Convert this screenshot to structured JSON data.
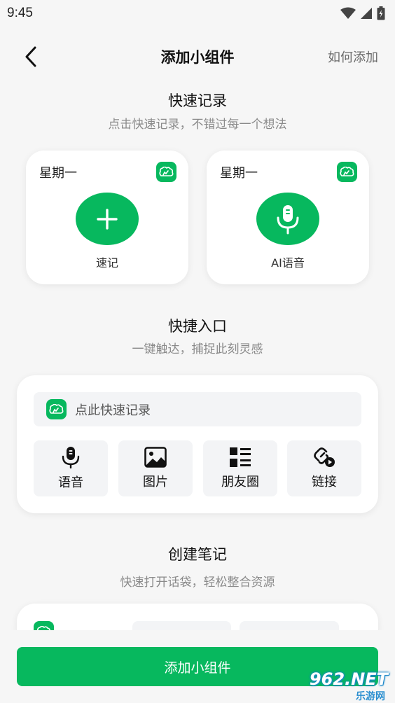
{
  "status_bar": {
    "time": "9:45"
  },
  "nav": {
    "title": "添加小组件",
    "help_label": "如何添加"
  },
  "sections": {
    "quick_record": {
      "title": "快速记录",
      "subtitle": "点击快速记录，不错过每一个想法"
    },
    "quick_entry": {
      "title": "快捷入口",
      "subtitle": "一键触达，捕捉此刻灵感"
    },
    "create_note": {
      "title": "创建笔记",
      "subtitle": "快速打开话袋，轻松整合资源"
    }
  },
  "widgets": [
    {
      "day": "星期一",
      "label": "速记",
      "icon": "plus-icon"
    },
    {
      "day": "星期一",
      "label": "AI语音",
      "icon": "microphone-icon"
    }
  ],
  "entry_card": {
    "search_placeholder": "点此快速记录",
    "buttons": [
      {
        "label": "语音",
        "icon": "microphone-icon"
      },
      {
        "label": "图片",
        "icon": "image-icon"
      },
      {
        "label": "朋友圈",
        "icon": "moments-grid-icon"
      },
      {
        "label": "链接",
        "icon": "link-play-icon"
      }
    ]
  },
  "footer": {
    "button_label": "添加小组件"
  },
  "colors": {
    "brand_green": "#07b85e",
    "background": "#f6f6f6",
    "card": "#ffffff",
    "tile": "#f3f4f6"
  },
  "watermark": {
    "main": "962.NET",
    "sub": "乐游网"
  }
}
